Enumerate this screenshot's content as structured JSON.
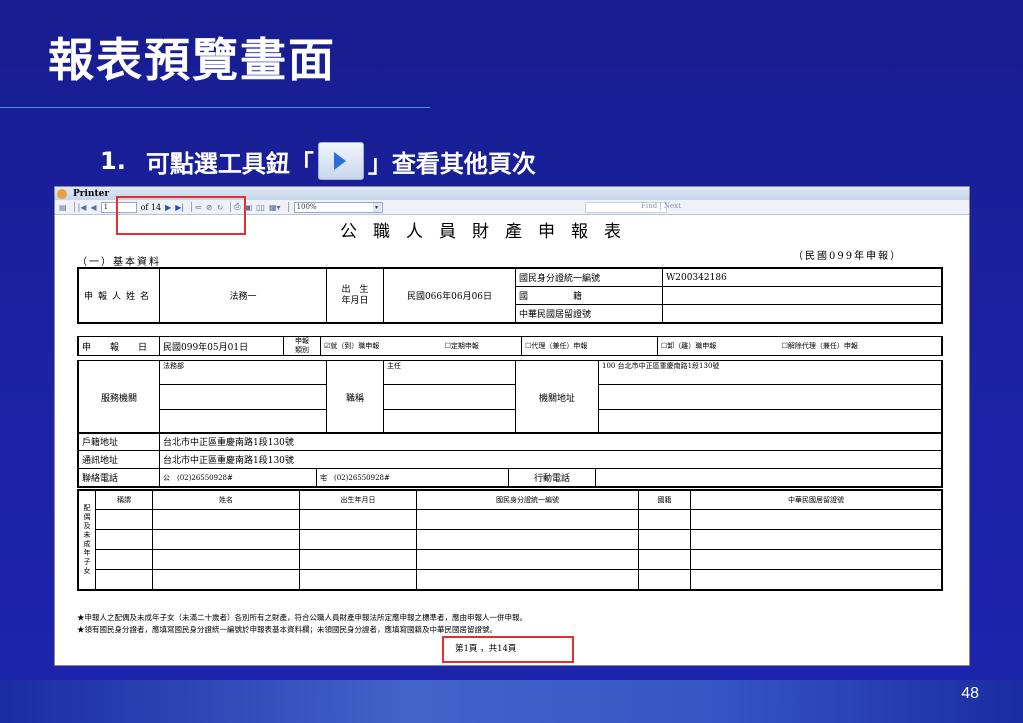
{
  "slide": {
    "title": "報表預覽畫面",
    "bullet_number": "1.",
    "bullet_text_before": "可點選工具鈕「",
    "bullet_text_after": "」查看其他頁次",
    "page_number": "48"
  },
  "viewer": {
    "window_title": "Printer",
    "page_input": "1",
    "page_total": "of 14",
    "zoom": "100%",
    "find_label": "Find | Next"
  },
  "form": {
    "title": "公職人員財產申報表",
    "section1": "（一）基本資料",
    "year_note": "（民國099年申報）",
    "lbl_name": "申報人姓名",
    "val_name": "法務一",
    "lbl_birth_1": "出　生",
    "lbl_birth_2": "年月日",
    "val_birth": "民國066年06月06日",
    "lbl_id": "國民身分證統一編號",
    "val_id": "W200342186",
    "lbl_nation": "國　　　　　籍",
    "lbl_resid": "中華民國居留證號",
    "lbl_date": "申　報　日",
    "val_date": "民國099年05月01日",
    "lbl_type_1": "申報",
    "lbl_type_2": "類別",
    "opt_1": "☑就（到）職申報",
    "opt_2": "☐定期申報",
    "opt_3": "☐代理（兼任）申報",
    "opt_4": "☐卸（離）職申報",
    "opt_5": "☐解除代理（兼任）申報",
    "lbl_org": "服務機關",
    "val_org": "法務部",
    "lbl_title": "職稱",
    "val_title": "主任",
    "lbl_org_addr": "機關地址",
    "val_org_addr": "100 台北市中正區重慶南路1段130號",
    "lbl_reg_addr": "戶籍地址",
    "val_reg_addr": "台北市中正區重慶南路1段130號",
    "lbl_mail_addr": "通訊地址",
    "val_mail_addr": "台北市中正區重慶南路1段130號",
    "lbl_phone": "聯絡電話",
    "lbl_office": "公",
    "val_office": "(02)26550928#",
    "lbl_home": "宅",
    "val_home": "(02)26550928#",
    "lbl_mobile": "行動電話",
    "fam_side": "配偶及未成年子女",
    "fam_headers": [
      "稱謂",
      "姓名",
      "出生年月日",
      "國民身分證統一編號",
      "國籍",
      "中華民國居留證號"
    ],
    "note_1": "★申報人之配偶及未成年子女（未滿二十歲者）各別所有之財產，符合公職人員財產申報法所定應申報之標準者，應由申報人一併申報。",
    "note_2": "★領有國民身分證者，應填寫國民身分證統一編號於申報表基本資料欄；未領國民身分證者，應填寫國籍及中華民國居留證號。",
    "page_footer": "第1頁 ，共14頁"
  },
  "colors": {
    "slide_bg": "#1a1f9c",
    "highlight": "#e03030"
  }
}
